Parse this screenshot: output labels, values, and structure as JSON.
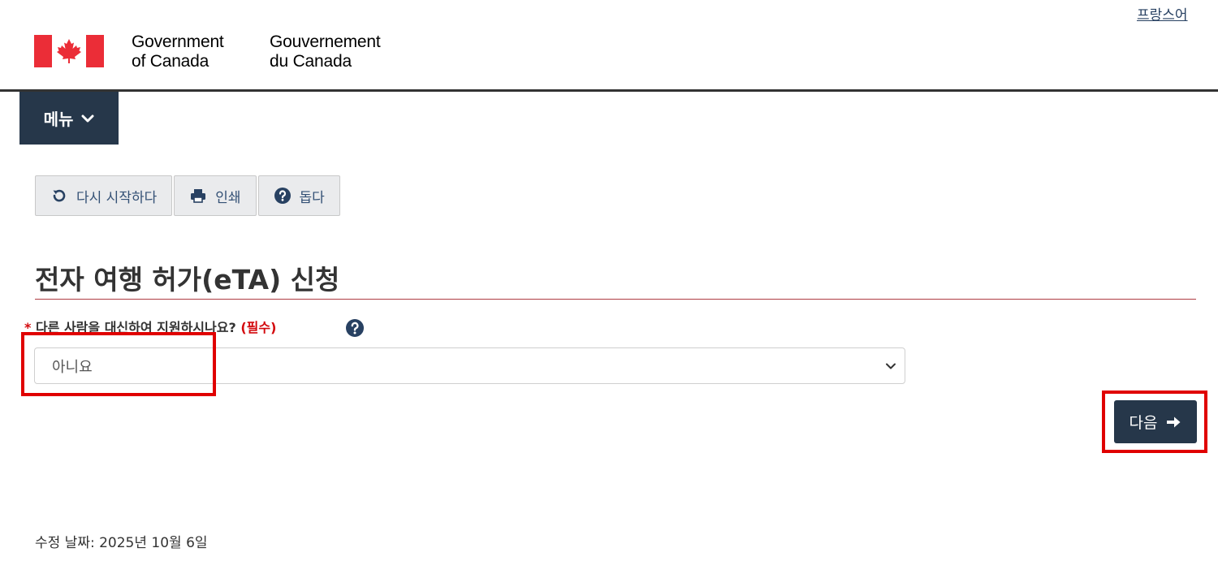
{
  "header": {
    "language_link": "프랑스어",
    "signature_en": [
      "Government",
      "of Canada"
    ],
    "signature_fr": [
      "Gouvernement",
      "du Canada"
    ],
    "flag_color": "#eb2d37"
  },
  "menu": {
    "label": "메뉴",
    "icon": "chevron-down-icon"
  },
  "toolbar": {
    "restart_label": "다시 시작하다",
    "print_label": "인쇄",
    "help_label": "돕다"
  },
  "main": {
    "title": "전자 여행 허가(eTA) 신청",
    "question": {
      "required_marker": "*",
      "text": "다른 사람을 대신하여 지원하시나요?",
      "required_label": "(필수)"
    },
    "select": {
      "selected_value": "아니요"
    },
    "next_label": "다음"
  },
  "footer": {
    "date_modified_label": "수정 날짜:",
    "date_modified_value": "2025년 10월 6일"
  },
  "colors": {
    "nav_bg": "#26374a",
    "title_rule": "#af3c43",
    "required": "#d3080c",
    "highlight": "#e00000"
  }
}
